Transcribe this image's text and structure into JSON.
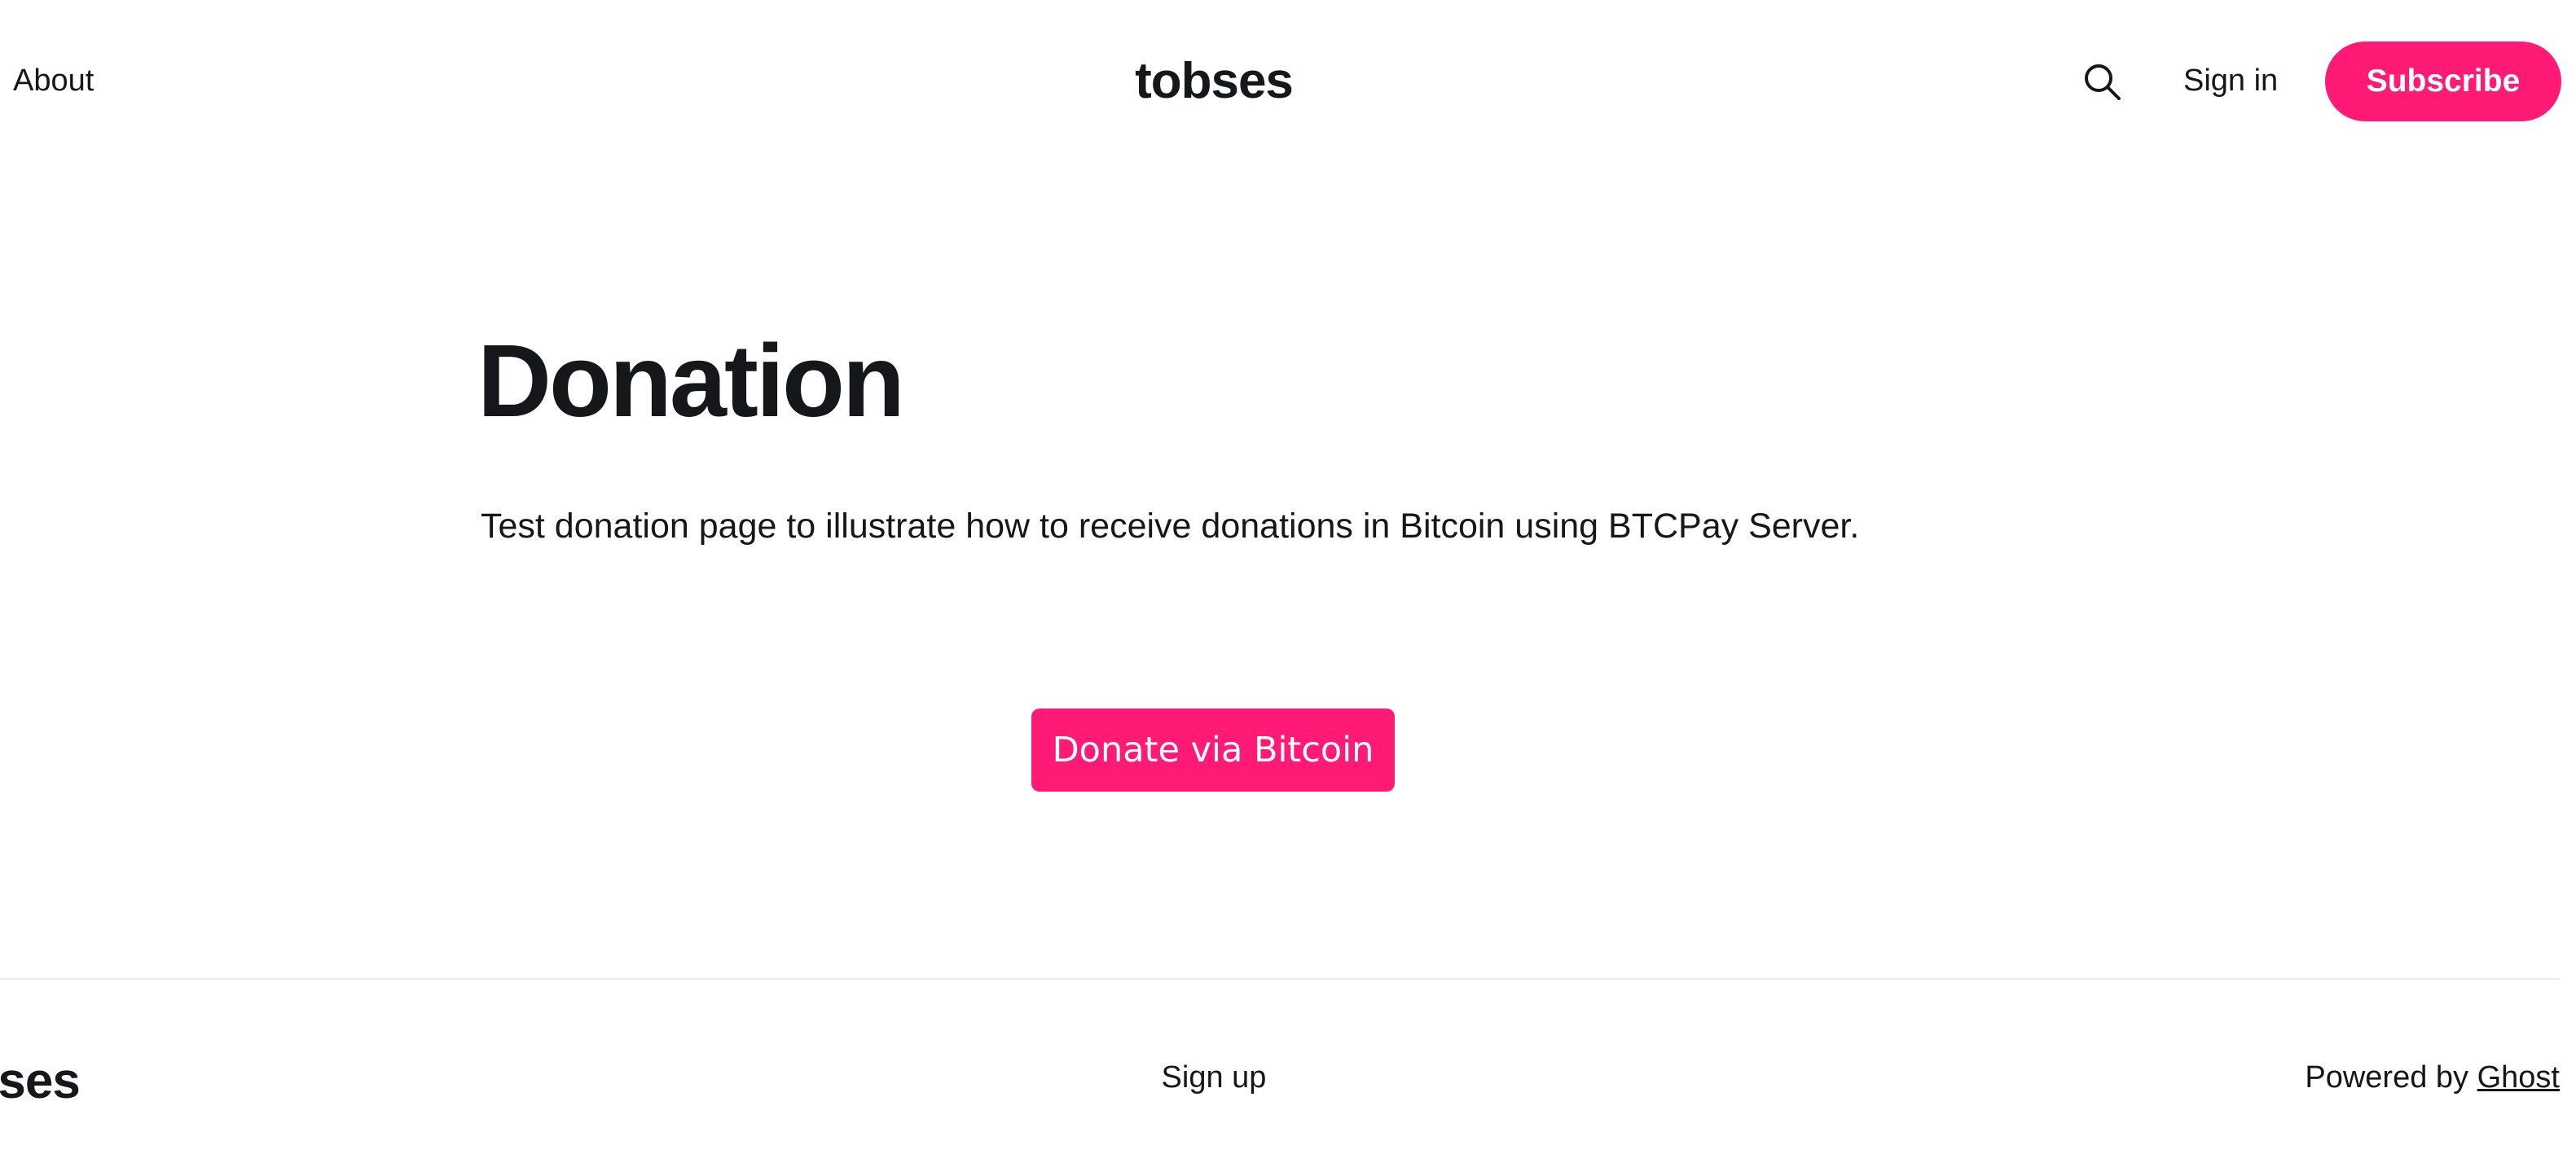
{
  "header": {
    "nav_about": "About",
    "site_title": "tobses",
    "search_icon": "search-icon",
    "signin_label": "Sign in",
    "subscribe_label": "Subscribe"
  },
  "main": {
    "title": "Donation",
    "excerpt": "Test donation page to illustrate how to receive donations in Bitcoin using BTCPay Server.",
    "donate_label": "Donate via Bitcoin"
  },
  "footer": {
    "site_title": "tobses",
    "signup_label": "Sign up",
    "powered_prefix": "Powered by",
    "powered_link": "Ghost"
  },
  "colors": {
    "accent": "#ff1a75",
    "text": "#15171a",
    "divider": "#ebebeb"
  }
}
